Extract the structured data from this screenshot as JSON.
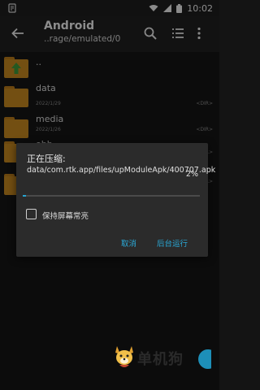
{
  "status_bar": {
    "time": "10:02"
  },
  "toolbar": {
    "title": "Android",
    "path": "..rage/emulated/0"
  },
  "files": [
    {
      "name": "..",
      "date": "",
      "type": ""
    },
    {
      "name": "data",
      "date": "2022/1/29",
      "type": "<DIR>"
    },
    {
      "name": "media",
      "date": "2022/1/26",
      "type": "<DIR>"
    },
    {
      "name": "obb",
      "date": "",
      "type": "<DIR>"
    },
    {
      "name": "",
      "date": "",
      "type": "<DIR>"
    }
  ],
  "dialog": {
    "title": "正在压缩:",
    "path": "data/com.rtk.app/files/upModuleApk/400707.apk",
    "percent": "2%",
    "progress_value": 0.02,
    "checkbox_label": "保持屏幕常亮",
    "cancel_label": "取消",
    "background_label": "后台运行"
  },
  "watermark": {
    "text": "单机狗"
  },
  "colors": {
    "accent": "#27a4d0",
    "folder": "#c68820",
    "dialog_bg": "#2b2b2b"
  }
}
